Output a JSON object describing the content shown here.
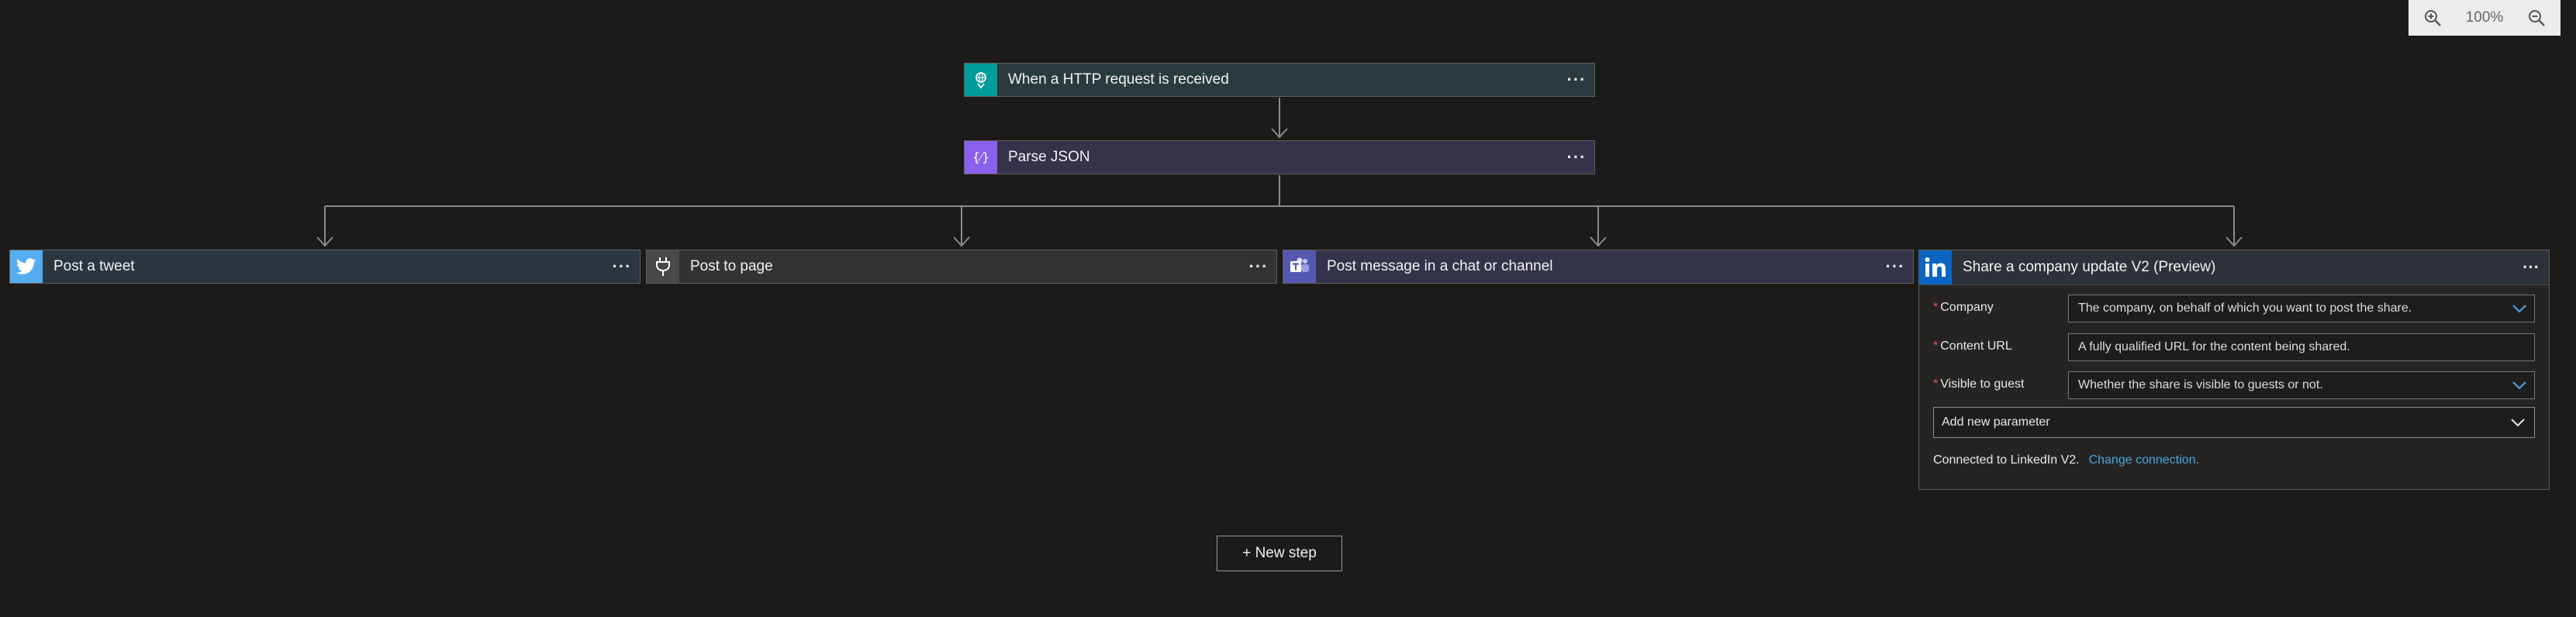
{
  "zoom": {
    "level": "100%",
    "zoom_in_icon": "zoom-in-icon",
    "zoom_out_icon": "zoom-out-icon"
  },
  "colors": {
    "canvas_bg": "#1c1b1a",
    "http_accent": "#009c9b",
    "parse_accent": "#8a61ec",
    "twitter_accent": "#55acee",
    "plug_accent": "#4a4846",
    "teams_accent": "#5558af",
    "linkedin_accent": "#0a66c2",
    "link": "#4aa3e0",
    "required": "#e05454"
  },
  "steps": {
    "trigger": {
      "title": "When a HTTP request is received",
      "icon": "http-request-icon",
      "more": "···"
    },
    "parse": {
      "title": "Parse JSON",
      "icon": "parse-json-icon",
      "more": "···"
    }
  },
  "branches": [
    {
      "title": "Post a tweet",
      "icon": "twitter-icon",
      "more": "···"
    },
    {
      "title": "Post to page",
      "icon": "plug-icon",
      "more": "···"
    },
    {
      "title": "Post message in a chat or channel",
      "icon": "teams-icon",
      "more": "···"
    }
  ],
  "linkedin": {
    "title": "Share a company update V2 (Preview)",
    "icon": "linkedin-icon",
    "more": "···",
    "fields": [
      {
        "label": "Company",
        "required": "*",
        "placeholder": "The company, on behalf of which you want to post the share.",
        "dropdown": true
      },
      {
        "label": "Content URL",
        "required": "*",
        "placeholder": "A fully qualified URL for the content being shared.",
        "dropdown": false
      },
      {
        "label": "Visible to guest",
        "required": "*",
        "placeholder": "Whether the share is visible to guests or not.",
        "dropdown": true
      }
    ],
    "add_param": "Add new parameter",
    "connected_text": "Connected to LinkedIn V2.",
    "change_connection": "Change connection."
  },
  "new_step": "+ New step"
}
